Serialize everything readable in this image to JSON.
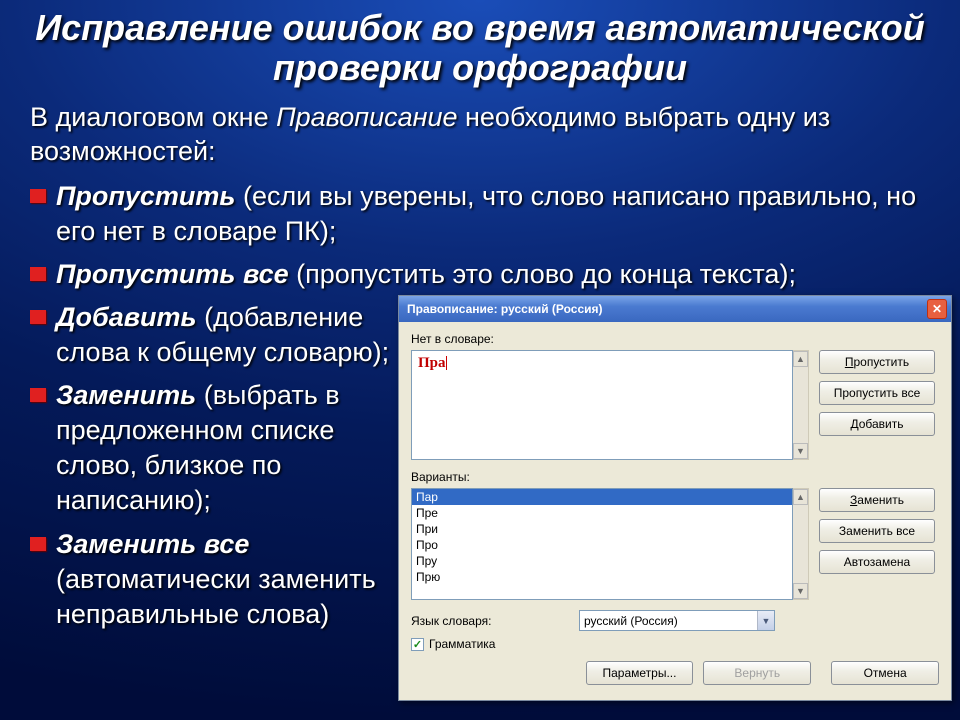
{
  "title": "Исправление ошибок во время автоматической проверки орфографии",
  "intro_pre": "В диалоговом окне ",
  "intro_em": "Правописание",
  "intro_post": " необходимо выбрать одну из возможностей:",
  "items": [
    {
      "term": "Пропустить",
      "rest": " (если вы уверены, что слово написано правильно, но его нет в словаре ПК);",
      "narrow": false
    },
    {
      "term": "Пропустить все",
      "rest": "  (пропустить это слово до конца текста);",
      "narrow": false
    },
    {
      "term": "Добавить",
      "rest": "  (добавление слова к общему словарю);",
      "narrow": true
    },
    {
      "term": "Заменить",
      "rest": "  (выбрать в предложенном списке слово, близкое по написанию);",
      "narrow": true
    },
    {
      "term": "Заменить все",
      "rest": " (автоматически заменить неправильные слова)",
      "narrow": true
    }
  ],
  "dialog": {
    "title": "Правописание: русский (Россия)",
    "close": "✕",
    "not_in_dict_label": "Нет в словаре:",
    "misspelled": "Пра",
    "variants_label": "Варианты:",
    "variants": [
      "Пар",
      "Пре",
      "При",
      "Про",
      "Пру",
      "Прю"
    ],
    "lang_label": "Язык словаря:",
    "lang_value": "русский (Россия)",
    "grammar_label": "Грамматика",
    "btn_skip": "Пропустить",
    "btn_skip_all": "Пропустить все",
    "btn_add": "Добавить",
    "btn_replace": "Заменить",
    "btn_replace_all": "Заменить все",
    "btn_autocorrect": "Автозамена",
    "btn_params": "Параметры...",
    "btn_revert": "Вернуть",
    "btn_cancel": "Отмена"
  }
}
